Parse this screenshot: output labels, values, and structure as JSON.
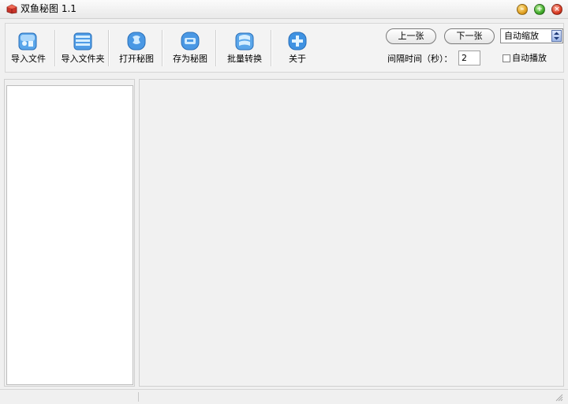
{
  "window": {
    "title": "双鱼秘图 1.1",
    "controls": [
      "minimize-icon",
      "maximize-icon",
      "close-icon"
    ]
  },
  "toolbar": {
    "items": [
      {
        "label": "导入文件",
        "icon": "import-file-icon"
      },
      {
        "label": "导入文件夹",
        "icon": "import-folder-icon"
      },
      {
        "label": "打开秘图",
        "icon": "open-secret-image-icon"
      },
      {
        "label": "存为秘图",
        "icon": "save-secret-image-icon"
      },
      {
        "label": "批量转换",
        "icon": "batch-convert-icon"
      },
      {
        "label": "关于",
        "icon": "about-icon"
      }
    ]
  },
  "navigation": {
    "prev_label": "上一张",
    "next_label": "下一张",
    "zoom_mode": "自动缩放",
    "interval_label": "间隔时间（秒）：",
    "interval_value": "2",
    "autoplay_label": "自动播放",
    "autoplay_checked": false
  },
  "colors": {
    "icon_blue": "#3d8ee0",
    "icon_light": "#b9e0ff",
    "window_bg": "#f0f0f0"
  }
}
